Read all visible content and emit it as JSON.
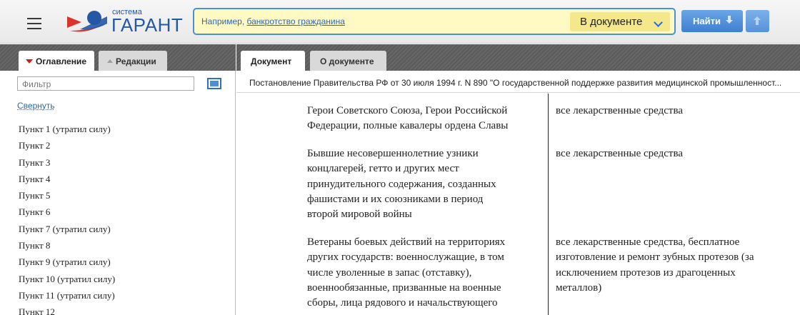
{
  "header": {
    "menu_icon": "hamburger-icon",
    "logo": {
      "subtitle": "система",
      "title": "ГАРАНТ",
      "mark_colors": [
        "#d9332e",
        "#2458a6"
      ]
    },
    "search": {
      "placeholder_prefix": "Например,",
      "placeholder_example": "банкротство гражданина",
      "scope": "В документе",
      "scope_icon": "chevron-down-icon"
    },
    "find_button": {
      "label": "Найти",
      "icon": "arrow-down-icon"
    },
    "prev_button": {
      "icon": "arrow-up-icon"
    }
  },
  "sidebar": {
    "tabs": [
      {
        "label": "Оглавление",
        "active": true,
        "icon": "triangle-down-icon"
      },
      {
        "label": "Редакции",
        "active": false,
        "icon": "triangle-up-icon"
      }
    ],
    "filter_placeholder": "Фильтр",
    "filter_icon": "panel-toggle-icon",
    "collapse_link": "Свернуть",
    "items": [
      "Пункт 1 (утратил силу)",
      "Пункт 2",
      "Пункт 3",
      "Пункт 4",
      "Пункт 5",
      "Пункт 6",
      "Пункт 7 (утратил силу)",
      "Пункт 8",
      "Пункт 9 (утратил силу)",
      "Пункт 10 (утратил силу)",
      "Пункт 11 (утратил силу)",
      "Пункт 12"
    ]
  },
  "document": {
    "tabs": [
      {
        "label": "Документ",
        "active": true
      },
      {
        "label": "О документе",
        "active": false
      }
    ],
    "title": "Постановление Правительства РФ от 30 июля 1994 г. N 890 \"О государственной поддержке развития медицинской промышленност...",
    "rows": [
      {
        "left": [
          "Герои Советского Союза, Герои Российской",
          "Федерации, полные кавалеры ордена Славы"
        ],
        "right": [
          "все лекарственные средства"
        ]
      },
      {
        "left": [
          "Бывшие несовершеннолетние узники",
          "концлагерей, гетто и других мест",
          "принудительного содержания, созданных",
          "фашистами и их союзниками в период",
          "второй мировой войны"
        ],
        "right": [
          "все лекарственные средства"
        ]
      },
      {
        "left": [
          "Ветераны боевых действий на территориях",
          "других государств: военнослужащие, в том",
          "числе уволенные в запас (отставку),",
          "военнообязанные, призванные на военные",
          "сборы, лица рядового и начальствующего"
        ],
        "right": [
          "все лекарственные средства, бесплатное",
          "изготовление и ремонт зубных протезов (за",
          "исключением протезов из драгоценных",
          "металлов)"
        ]
      }
    ]
  },
  "colors": {
    "accent_blue": "#4a8fd8",
    "search_bg": "#fff9c4",
    "link": "#2d6bb3",
    "tab_strip": "#606060",
    "marker_red": "#d11b1b"
  }
}
